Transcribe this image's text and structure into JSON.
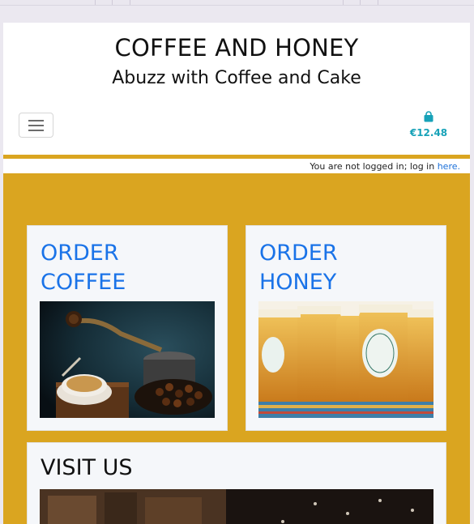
{
  "site": {
    "title": "COFFEE AND HONEY",
    "tagline": "Abuzz with Coffee and Cake"
  },
  "cart": {
    "total": "€12.48",
    "icon": "shopping-bag-icon"
  },
  "nav": {
    "toggle_icon": "hamburger-menu-icon"
  },
  "login_bar": {
    "text": "You are not logged in; log in ",
    "link_text": "here."
  },
  "cards": {
    "coffee": {
      "heading_line1": "ORDER",
      "heading_line2": "COFFEE"
    },
    "honey": {
      "heading_line1": "ORDER",
      "heading_line2": "HONEY"
    },
    "visit": {
      "heading": "VISIT US"
    }
  },
  "colors": {
    "accent_gold": "#daa520",
    "link_blue": "#1a73e8",
    "cart_teal": "#17a2b8"
  }
}
